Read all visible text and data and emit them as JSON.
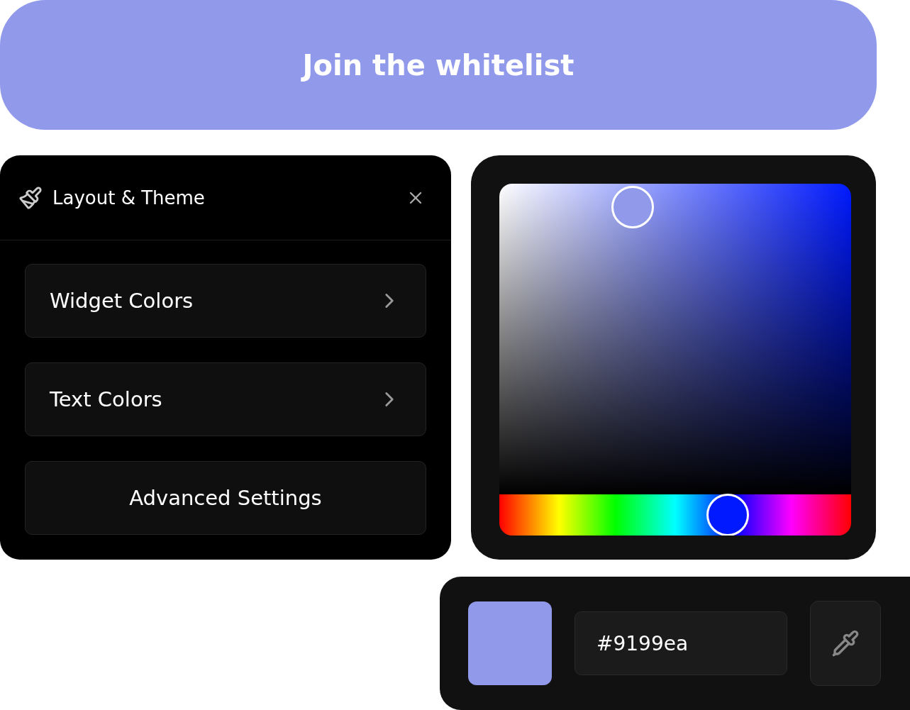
{
  "cta_button": {
    "label": "Join the whitelist"
  },
  "settings_panel": {
    "title": "Layout & Theme",
    "items": [
      {
        "kind": "submenu",
        "label": "Widget Colors"
      },
      {
        "kind": "submenu",
        "label": "Text Colors"
      },
      {
        "kind": "action",
        "label": "Advanced Settings"
      }
    ]
  },
  "color_picker": {
    "hue_slider": {
      "level": 0.65
    }
  },
  "color_output": {
    "hex_value": "#9199ea"
  }
}
